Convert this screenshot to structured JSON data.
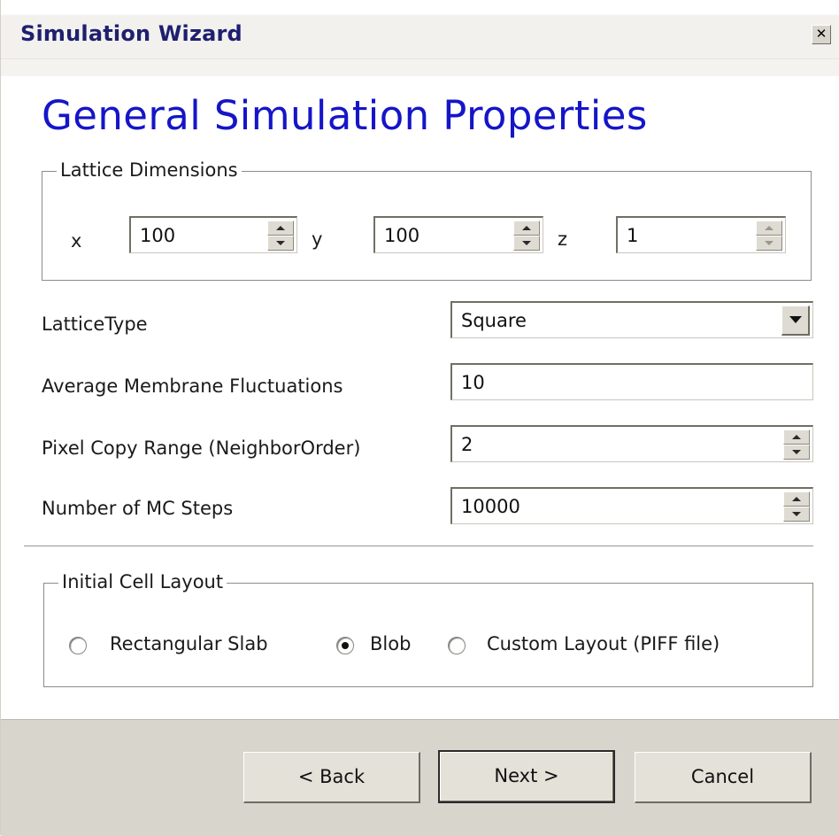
{
  "window": {
    "title": "Simulation Wizard",
    "close_glyph": "✕"
  },
  "heading": "General Simulation Properties",
  "lattice_dimensions": {
    "group_label": "Lattice Dimensions",
    "x": {
      "label": "x",
      "value": "100"
    },
    "y": {
      "label": "y",
      "value": "100"
    },
    "z": {
      "label": "z",
      "value": "1"
    }
  },
  "fields": {
    "lattice_type": {
      "label": "LatticeType",
      "value": "Square"
    },
    "membrane_fluctuations": {
      "label": "Average Membrane Fluctuations",
      "value": "10"
    },
    "pixel_copy_range": {
      "label": "Pixel Copy Range (NeighborOrder)",
      "value": "2"
    },
    "mc_steps": {
      "label": "Number of MC Steps",
      "value": "10000"
    }
  },
  "initial_cell_layout": {
    "group_label": "Initial Cell Layout",
    "options": [
      {
        "label": "Rectangular Slab",
        "selected": false
      },
      {
        "label": "Blob",
        "selected": true
      },
      {
        "label": "Custom Layout (PIFF file)",
        "selected": false
      }
    ]
  },
  "buttons": {
    "back": "< Back",
    "next": "Next >",
    "cancel": "Cancel"
  },
  "colors": {
    "heading": "#1515c8",
    "title_text": "#1f1f70",
    "footer_bg": "#d8d5cc"
  },
  "icons": {
    "close": "close-icon",
    "spin_up": "chevron-up-icon",
    "spin_down": "chevron-down-icon",
    "dropdown": "dropdown-arrow-icon"
  }
}
